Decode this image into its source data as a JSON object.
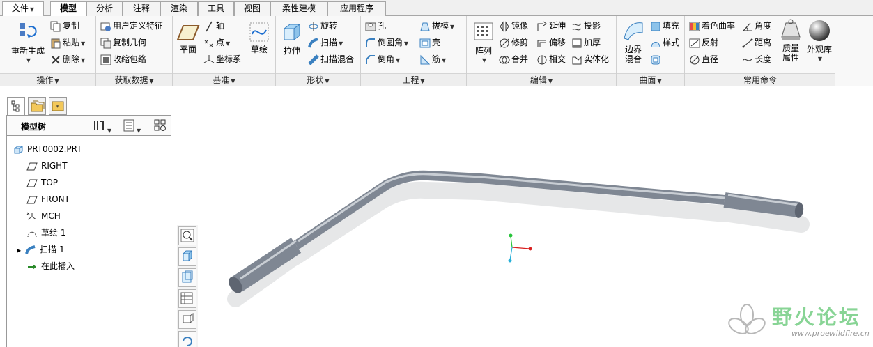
{
  "menu": {
    "file": "文件",
    "tabs": [
      "模型",
      "分析",
      "注释",
      "渲染",
      "工具",
      "视图",
      "柔性建模",
      "应用程序"
    ]
  },
  "ribbon": {
    "operations": {
      "regen": "重新生成",
      "copy": "复制",
      "paste": "粘贴",
      "delete": "删除",
      "footer": "操作"
    },
    "getdata": {
      "udf": "用户定义特征",
      "copygeom": "复制几何",
      "shrinkwrap": "收缩包络",
      "footer": "获取数据"
    },
    "datum": {
      "plane": "平面",
      "axis": "轴",
      "point": "点",
      "csys": "坐标系",
      "sketch": "草绘",
      "footer": "基准"
    },
    "shapes": {
      "extrude": "拉伸",
      "revolve": "旋转",
      "sweep": "扫描",
      "sweptblend": "扫描混合",
      "footer": "形状"
    },
    "engineering": {
      "hole": "孔",
      "round": "倒圆角",
      "chamfer": "倒角",
      "draft": "拔模",
      "shell": "壳",
      "rib": "筋",
      "footer": "工程"
    },
    "editing": {
      "pattern": "阵列",
      "mirror": "镜像",
      "trim": "修剪",
      "merge": "合并",
      "extend": "延伸",
      "offset": "偏移",
      "intersect": "相交",
      "project": "投影",
      "thicken": "加厚",
      "solidify": "实体化",
      "footer": "编辑"
    },
    "surfaces": {
      "boundary_1": "边界",
      "boundary_2": "混合",
      "fill": "填充",
      "style": "样式",
      "footer": "曲面"
    },
    "common": {
      "shade": "着色曲率",
      "reflect": "反射",
      "diameter": "直径",
      "angle": "角度",
      "distance": "距离",
      "length": "长度",
      "mass_1": "质量",
      "mass_2": "属性",
      "appearance": "外观库",
      "footer": "常用命令"
    }
  },
  "tree": {
    "title": "模型树",
    "items": [
      "PRT0002.PRT",
      "RIGHT",
      "TOP",
      "FRONT",
      "MCH",
      "草绘 1",
      "扫描 1",
      "在此插入"
    ]
  },
  "watermark": {
    "title": "野火论坛",
    "url": "www.proewildfire.cn"
  },
  "colors": {
    "part": "#8b929d",
    "accent": "#1e6fd0",
    "watermark": "#7cd08a"
  }
}
